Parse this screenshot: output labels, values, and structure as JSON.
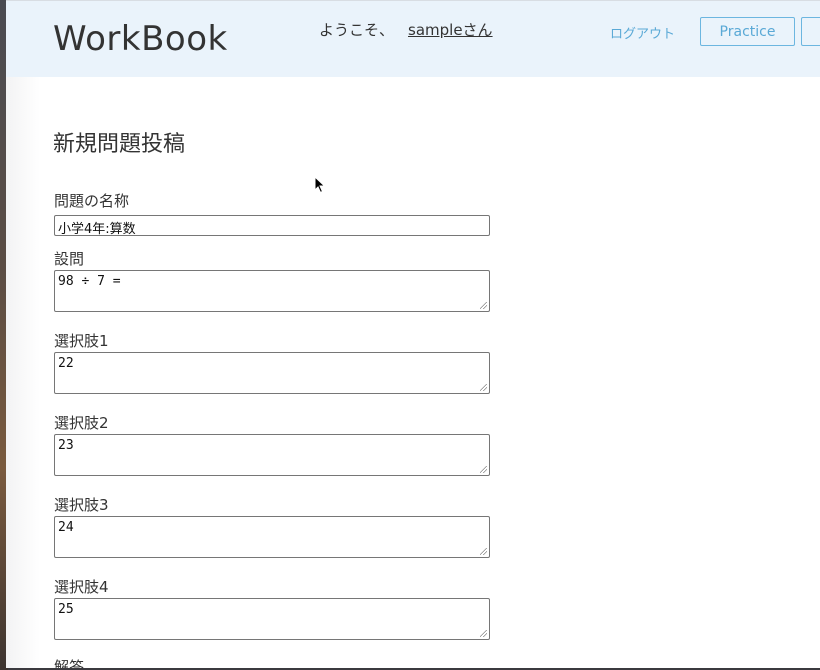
{
  "header": {
    "logo": "WorkBook",
    "welcome_prefix": "ようこそ、",
    "username": "sampleさん",
    "logout_label": "ログアウト",
    "practice_label": "Practice"
  },
  "form": {
    "page_title": "新規問題投稿",
    "title_label": "問題の名称",
    "title_value": "小学4年:算数",
    "question_label": "設問",
    "question_value": "98 ÷ 7 =",
    "choices": [
      {
        "label": "選択肢1",
        "value": "22"
      },
      {
        "label": "選択肢2",
        "value": "23"
      },
      {
        "label": "選択肢3",
        "value": "24"
      },
      {
        "label": "選択肢4",
        "value": "25"
      }
    ],
    "answer_label": "解答"
  }
}
